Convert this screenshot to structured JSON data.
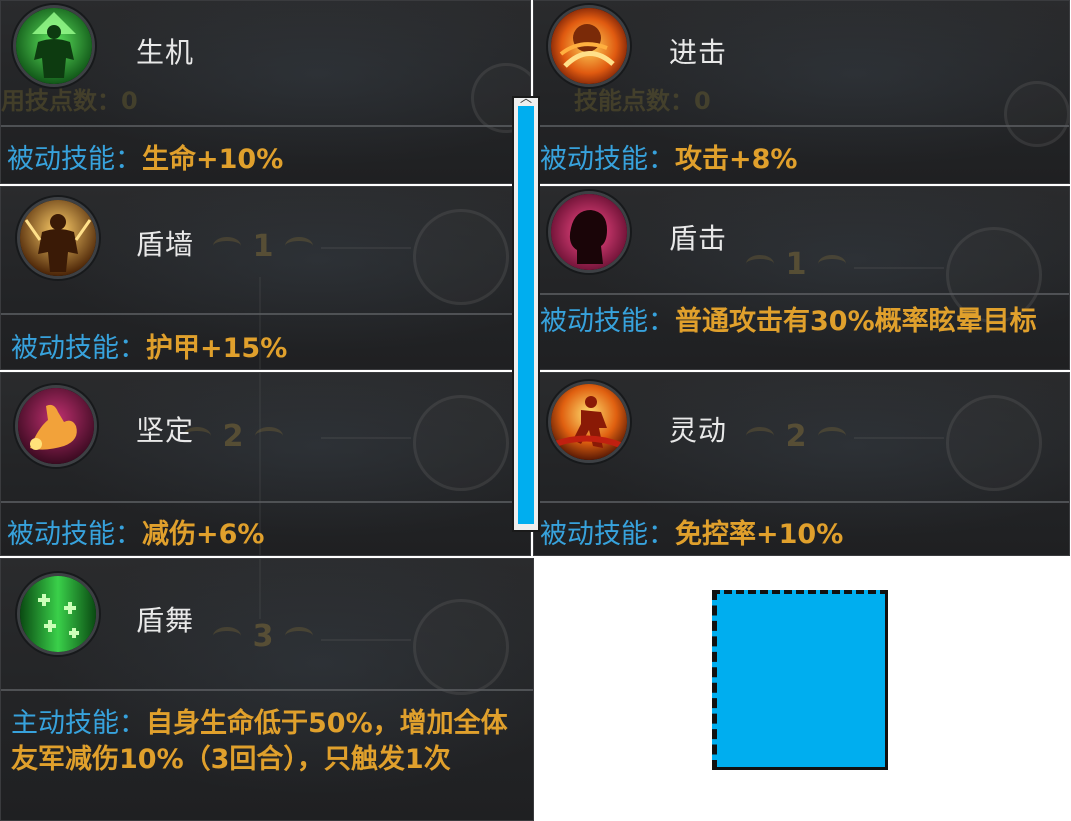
{
  "colors": {
    "card_bg": "#232426",
    "label_blue": "#37a2dc",
    "value_orange": "#e0a02c",
    "name_white": "#e8e8e8",
    "scroll_blue": "#00aeef"
  },
  "skills": [
    {
      "name": "生机",
      "icon": "green-muscle-figure-icon",
      "desc_label": "被动技能：",
      "desc_text": "生命+10%",
      "bg_text": "用技点数：0"
    },
    {
      "name": "进击",
      "icon": "flaming-fist-icon",
      "desc_label": "被动技能：",
      "desc_text": "攻击+8%",
      "bg_text": "技能点数：0"
    },
    {
      "name": "盾墙",
      "icon": "golden-warrior-icon",
      "desc_label": "被动技能：",
      "desc_text": "护甲+15%",
      "bg_badge": "1"
    },
    {
      "name": "盾击",
      "icon": "pink-silhouette-head-icon",
      "desc_label": "被动技能：",
      "desc_text": "普通攻击有30%概率眩晕目标",
      "bg_badge": "1"
    },
    {
      "name": "坚定",
      "icon": "flexed-arm-icon",
      "desc_label": "被动技能：",
      "desc_text": "减伤+6%",
      "bg_badge": "2"
    },
    {
      "name": "灵动",
      "icon": "dashing-figure-icon",
      "desc_label": "被动技能：",
      "desc_text": "免控率+10%",
      "bg_badge": "2"
    },
    {
      "name": "盾舞",
      "icon": "green-sparkle-icon",
      "desc_label": "主动技能：",
      "desc_text": "自身生命低于50%，增加全体友军减伤10%（3回合），只触发1次",
      "bg_badge": "3"
    }
  ]
}
